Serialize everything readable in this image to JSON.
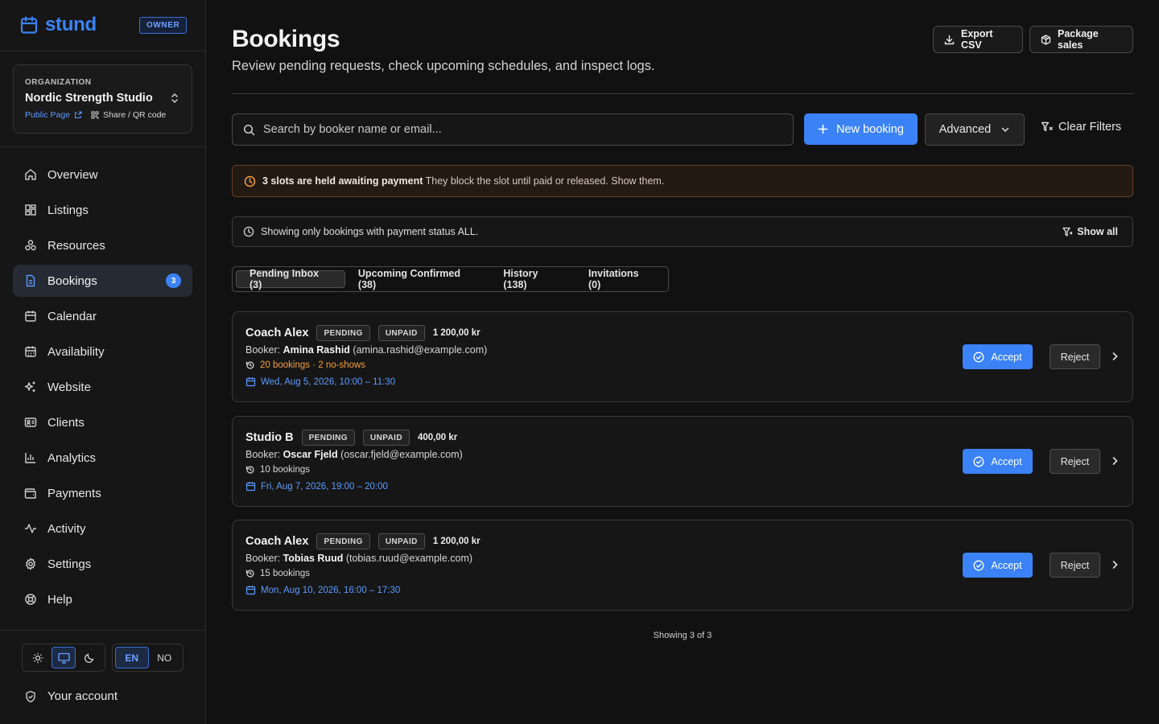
{
  "brand": {
    "name": "stund",
    "role_badge": "OWNER"
  },
  "organization": {
    "label": "ORGANIZATION",
    "name": "Nordic Strength Studio",
    "public_page": "Public Page",
    "share": "Share / QR code"
  },
  "nav": {
    "items": [
      {
        "label": "Overview",
        "icon": "home-icon"
      },
      {
        "label": "Listings",
        "icon": "grid-icon"
      },
      {
        "label": "Resources",
        "icon": "shapes-icon"
      },
      {
        "label": "Bookings",
        "icon": "document-icon",
        "badge": "3",
        "active": true
      },
      {
        "label": "Calendar",
        "icon": "calendar-icon"
      },
      {
        "label": "Availability",
        "icon": "calendar-grid-icon"
      },
      {
        "label": "Website",
        "icon": "sparkles-icon"
      },
      {
        "label": "Clients",
        "icon": "id-card-icon"
      },
      {
        "label": "Analytics",
        "icon": "bar-chart-icon"
      },
      {
        "label": "Payments",
        "icon": "wallet-icon"
      },
      {
        "label": "Activity",
        "icon": "activity-icon"
      },
      {
        "label": "Settings",
        "icon": "gear-icon"
      },
      {
        "label": "Help",
        "icon": "lifebuoy-icon"
      }
    ]
  },
  "theme": {
    "selected": "system"
  },
  "language": {
    "options": [
      "EN",
      "NO"
    ],
    "selected": "EN"
  },
  "account": {
    "label": "Your account"
  },
  "header": {
    "title": "Bookings",
    "subtitle": "Review pending requests, check upcoming schedules, and inspect logs.",
    "export_label": "Export CSV",
    "packages_label": "Package sales"
  },
  "toolbar": {
    "search_placeholder": "Search by booker name or email...",
    "new_booking": "New booking",
    "advanced": "Advanced",
    "clear_filters": "Clear Filters"
  },
  "alert": {
    "strong": "3 slots are held awaiting payment",
    "text": "They block the slot until paid or released. Show them."
  },
  "filter": {
    "text": "Showing only bookings with payment status ALL.",
    "show_all": "Show all"
  },
  "tabs": [
    {
      "label": "Pending Inbox (3)",
      "active": true
    },
    {
      "label": "Upcoming Confirmed (38)"
    },
    {
      "label": "History (138)"
    },
    {
      "label": "Invitations (0)"
    }
  ],
  "bookings": [
    {
      "title": "Coach Alex",
      "status": "PENDING",
      "payment": "UNPAID",
      "price": "1 200,00 kr",
      "booker_prefix": "Booker:",
      "booker_name": "Amina Rashid",
      "booker_email": "(amina.rashid@example.com)",
      "stats": "20 bookings · 2 no-shows",
      "stats_warning": true,
      "when": "Wed, Aug 5, 2026, 10:00 – 11:30",
      "accept": "Accept",
      "reject": "Reject"
    },
    {
      "title": "Studio B",
      "status": "PENDING",
      "payment": "UNPAID",
      "price": "400,00 kr",
      "booker_prefix": "Booker:",
      "booker_name": "Oscar Fjeld",
      "booker_email": "(oscar.fjeld@example.com)",
      "stats": "10 bookings",
      "stats_warning": false,
      "when": "Fri, Aug 7, 2026, 19:00 – 20:00",
      "accept": "Accept",
      "reject": "Reject"
    },
    {
      "title": "Coach Alex",
      "status": "PENDING",
      "payment": "UNPAID",
      "price": "1 200,00 kr",
      "booker_prefix": "Booker:",
      "booker_name": "Tobias Ruud",
      "booker_email": "(tobias.ruud@example.com)",
      "stats": "15 bookings",
      "stats_warning": false,
      "when": "Mon, Aug 10, 2026, 16:00 – 17:30",
      "accept": "Accept",
      "reject": "Reject"
    }
  ],
  "footer": {
    "showing": "Showing 3 of 3"
  },
  "colors": {
    "accent": "#3b82f6",
    "warning": "#f59e3b",
    "background": "#111111"
  }
}
